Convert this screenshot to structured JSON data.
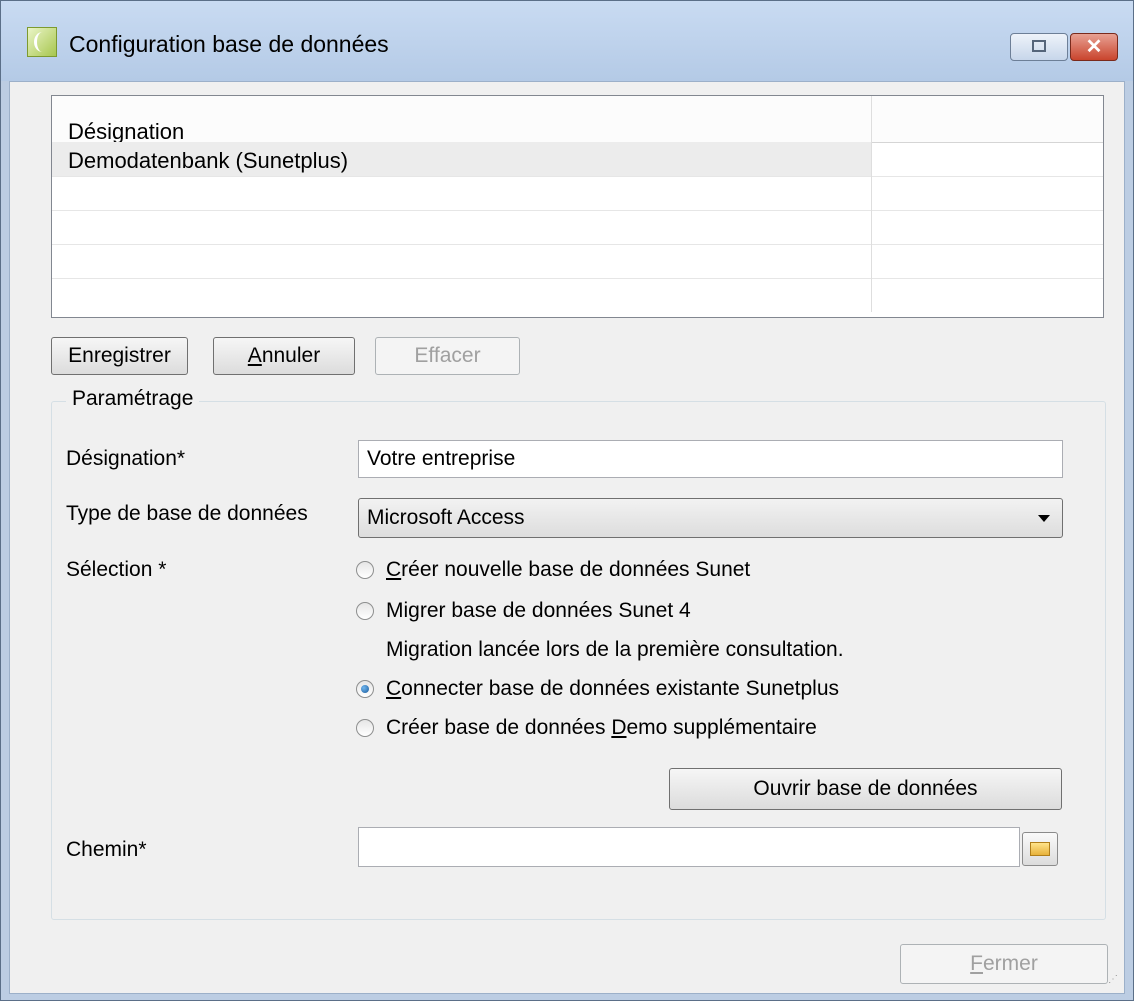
{
  "window": {
    "title": "Configuration base de données"
  },
  "grid": {
    "column_header": "Désignation",
    "rows": [
      "Demodatenbank (Sunetplus)",
      "",
      "",
      ""
    ]
  },
  "toolbar": {
    "save_label": "Enregistrer",
    "cancel_label_underlined": "A",
    "cancel_label_rest": "nnuler",
    "delete_label": "Effacer"
  },
  "settings": {
    "group_title": "Paramétrage",
    "designation_label": "Désignation*",
    "designation_value": "Votre entreprise",
    "db_type_label": "Type de base de données",
    "db_type_value": "Microsoft Access",
    "selection_label": "Sélection *",
    "radio_options": [
      {
        "pre": "",
        "u": "C",
        "post": "réer nouvelle base de données Sunet",
        "checked": false
      },
      {
        "pre": "",
        "u": "",
        "post": "Migrer base de données Sunet 4",
        "checked": false
      },
      {
        "pre": "",
        "u": "C",
        "post": "onnecter base de données existante Sunetplus",
        "checked": true
      },
      {
        "pre": "Créer base de données ",
        "u": "D",
        "post": "emo supplémentaire",
        "checked": false
      }
    ],
    "migration_note": "Migration lancée lors de la première consultation.",
    "open_db_button": "Ouvrir base de données",
    "path_label": "Chemin*",
    "path_value": ""
  },
  "footer": {
    "close_label_underlined": "F",
    "close_label_rest": "ermer"
  },
  "icons": {
    "app": "app-icon",
    "restore": "restore-icon",
    "close": "close-icon",
    "folder": "folder-icon",
    "dropdown": "chevron-down-icon"
  }
}
